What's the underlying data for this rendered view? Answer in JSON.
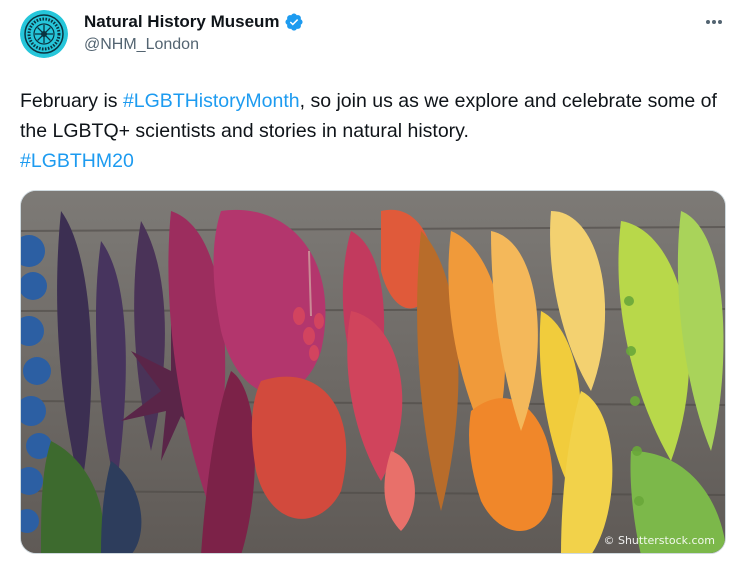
{
  "account": {
    "display_name": "Natural History Museum",
    "handle": "@NHM_London",
    "verified": true,
    "avatar_icon": "nhm-logo-icon"
  },
  "menu": {
    "icon": "more-options-icon"
  },
  "post": {
    "segments": [
      {
        "text": "February is ",
        "kind": "plain"
      },
      {
        "text": "#LGBTHistoryMonth",
        "kind": "hashtag"
      },
      {
        "text": ", so join us as we explore and celebrate some of the LGBTQ+ scientists and stories in natural history.",
        "kind": "plain"
      }
    ],
    "hashtag_line": "#LGBTHM20"
  },
  "media": {
    "watermark": "© Shutterstock.com"
  },
  "colors": {
    "text": "#0f1419",
    "secondary": "#536471",
    "link": "#1d9bf0",
    "verified": "#1d9bf0",
    "avatar_bg": "#26c6da"
  }
}
